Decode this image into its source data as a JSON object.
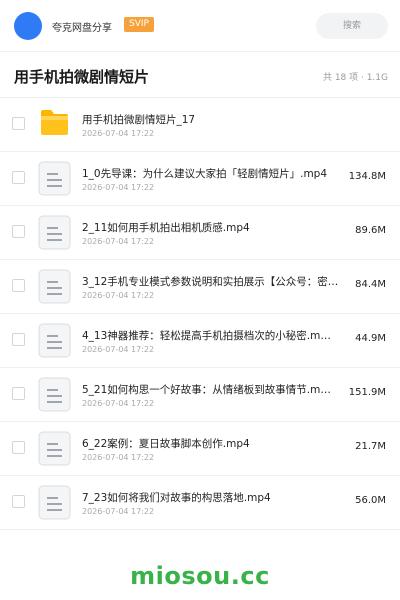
{
  "topbar": {
    "share_title": "夸克网盘分享",
    "badge": "SVIP",
    "search_placeholder": "搜索"
  },
  "header": {
    "title": "用手机拍微剧情短片",
    "summary": "共 18 项 · 1.1G"
  },
  "files": [
    {
      "name": "用手机拍微剧情短片_17",
      "date": "2026-07-04 17:22",
      "size": "",
      "icon": "folder-icon"
    },
    {
      "name": "1_0先导课：为什么建议大家拍「轻剧情短片」.mp4",
      "date": "2026-07-04 17:22",
      "size": "134.8M",
      "icon": "file-icon"
    },
    {
      "name": "2_11如何用手机拍出相机质感.mp4",
      "date": "2026-07-04 17:22",
      "size": "89.6M",
      "icon": "file-icon"
    },
    {
      "name": "3_12手机专业模式参数说明和实拍展示【公众号：密…",
      "date": "2026-07-04 17:22",
      "size": "84.4M",
      "icon": "file-icon"
    },
    {
      "name": "4_13神器推荐：轻松提高手机拍摄档次的小秘密.m…",
      "date": "2026-07-04 17:22",
      "size": "44.9M",
      "icon": "file-icon"
    },
    {
      "name": "5_21如何构思一个好故事：从情绪板到故事情节.m…",
      "date": "2026-07-04 17:22",
      "size": "151.9M",
      "icon": "file-icon"
    },
    {
      "name": "6_22案例：夏日故事脚本创作.mp4",
      "date": "2026-07-04 17:22",
      "size": "21.7M",
      "icon": "file-icon"
    },
    {
      "name": "7_23如何将我们对故事的构思落地.mp4",
      "date": "2026-07-04 17:22",
      "size": "56.0M",
      "icon": "file-icon"
    }
  ],
  "watermark": "miosou.cc",
  "colors": {
    "avatar": "#2f7bf5",
    "svip_badge": "#f7a13a",
    "folder": "#ffc21a",
    "watermark": "#37b34a"
  }
}
